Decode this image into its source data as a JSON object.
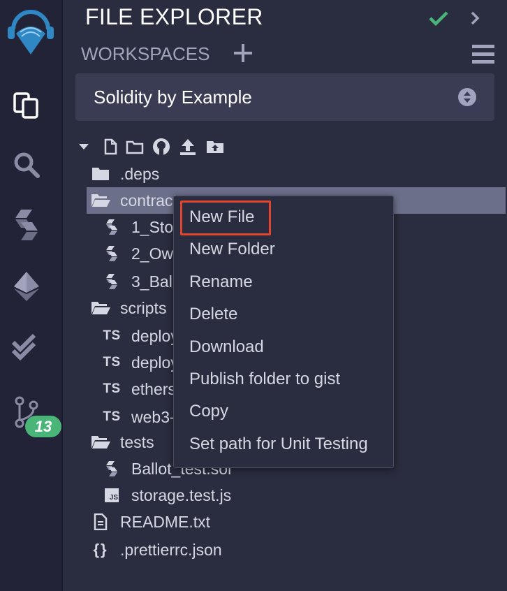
{
  "sidebar": {
    "icons": [
      "remix-logo-icon",
      "file-explorer-icon",
      "search-icon",
      "solidity-compiler-icon",
      "deploy-run-icon",
      "testing-icon",
      "git-icon"
    ],
    "git_badge": "13"
  },
  "header": {
    "title": "FILE EXPLORER",
    "workspaces_label": "WORKSPACES",
    "workspace_selected": "Solidity by Example"
  },
  "tree": {
    "items": [
      {
        "label": ".deps",
        "type": "folder"
      },
      {
        "label": "contracts",
        "type": "folder-open",
        "selected": true
      },
      {
        "label": "1_Storage.sol",
        "type": "sol"
      },
      {
        "label": "2_Owner.sol",
        "type": "sol"
      },
      {
        "label": "3_Ballot.sol",
        "type": "sol"
      },
      {
        "label": "scripts",
        "type": "folder-open"
      },
      {
        "label": "deploy_with_ethers.ts",
        "type": "ts"
      },
      {
        "label": "deploy_with_web3.ts",
        "type": "ts"
      },
      {
        "label": "ethers-lib.ts",
        "type": "ts"
      },
      {
        "label": "web3-lib.ts",
        "type": "ts"
      },
      {
        "label": "tests",
        "type": "folder-open"
      },
      {
        "label": "Ballot_test.sol",
        "type": "sol"
      },
      {
        "label": "storage.test.js",
        "type": "js"
      },
      {
        "label": "README.txt",
        "type": "txt"
      },
      {
        "label": ".prettierrc.json",
        "type": "json"
      }
    ]
  },
  "context_menu": {
    "items": [
      "New File",
      "New Folder",
      "Rename",
      "Delete",
      "Download",
      "Publish folder to gist",
      "Copy",
      "Set path for Unit Testing"
    ],
    "highlighted": "New File"
  },
  "colors": {
    "accent_check": "#4ab578",
    "highlight": "#e0452f",
    "badge": "#4ab578"
  }
}
